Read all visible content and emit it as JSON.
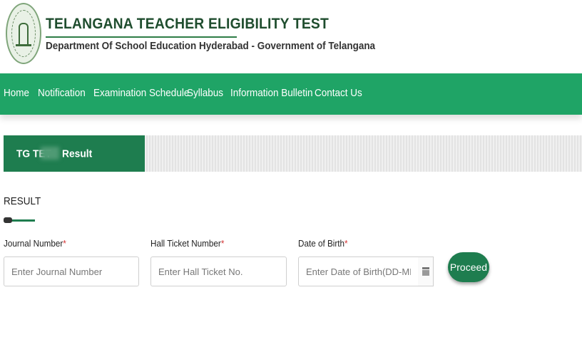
{
  "header": {
    "title": "TELANGANA TEACHER ELIGIBILITY TEST",
    "subtitle": "Department Of School Education Hyderabad - Government of Telangana",
    "logo_icon": "telangana-emblem-icon"
  },
  "nav": {
    "items": [
      {
        "label": "Home"
      },
      {
        "label": "Notification"
      },
      {
        "label": "Examination Schedule"
      },
      {
        "label": "Syllabus"
      },
      {
        "label": "Information Bulletin"
      },
      {
        "label": "Contact Us"
      }
    ]
  },
  "banner": {
    "prefix": "TG TET",
    "suffix": "Result"
  },
  "form": {
    "section_title": "RESULT",
    "required_mark": "*",
    "journal_label": "Journal Number",
    "journal_placeholder": "Enter Journal Number",
    "hall_label": "Hall Ticket Number",
    "hall_placeholder": "Enter Hall Ticket No.",
    "dob_label": "Date of Birth",
    "dob_placeholder": "Enter Date of Birth(DD-MM-YYY",
    "calendar_icon": "calendar-icon",
    "proceed_label": "Proceed"
  },
  "colors": {
    "nav_green": "#1fa466",
    "dark_green": "#1e7d4f",
    "title_green": "#1f4d2e",
    "required_red": "#d32f2f"
  }
}
